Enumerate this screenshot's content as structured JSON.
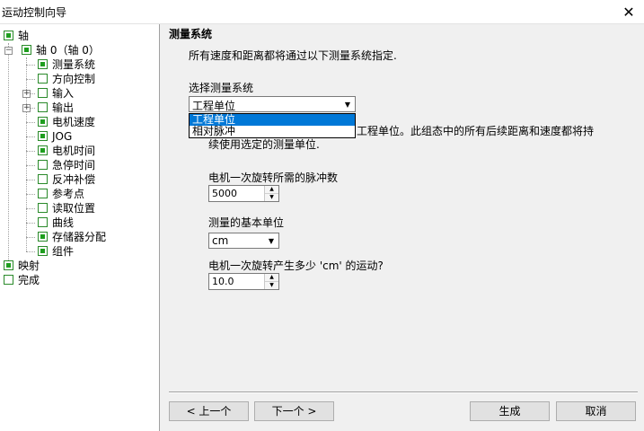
{
  "window": {
    "title": "运动控制向导"
  },
  "tree": {
    "items": [
      {
        "label": "轴",
        "checked": true
      },
      {
        "label": "轴 0（轴 0）",
        "checked": true
      },
      {
        "label": "测量系统",
        "checked": true
      },
      {
        "label": "方向控制",
        "checked": false
      },
      {
        "label": "输入",
        "checked": false
      },
      {
        "label": "输出",
        "checked": false
      },
      {
        "label": "电机速度",
        "checked": true
      },
      {
        "label": "JOG",
        "checked": true
      },
      {
        "label": "电机时间",
        "checked": true
      },
      {
        "label": "急停时间",
        "checked": false
      },
      {
        "label": "反冲补偿",
        "checked": false
      },
      {
        "label": "参考点",
        "checked": false
      },
      {
        "label": "读取位置",
        "checked": false
      },
      {
        "label": "曲线",
        "checked": false
      },
      {
        "label": "存储器分配",
        "checked": true
      },
      {
        "label": "组件",
        "checked": true
      },
      {
        "label": "映射",
        "checked": true
      },
      {
        "label": "完成",
        "checked": false
      }
    ]
  },
  "content": {
    "section_title": "测量系统",
    "description": "所有速度和距离都将通过以下测量系统指定.",
    "select_label": "选择测量系统",
    "select_value": "工程单位",
    "dropdown_options": [
      "工程单位",
      "相对脉冲"
    ],
    "hidden_text": "工程单位。此组态中的所有后续距离和速度都将持",
    "hidden_text_line2": "续使用选定的测量单位.",
    "pulses_label": "电机一次旋转所需的脉冲数",
    "pulses_value": "5000",
    "unit_label": "测量的基本单位",
    "unit_value": "cm",
    "motion_label": "电机一次旋转产生多少 'cm' 的运动?",
    "motion_value": "10.0"
  },
  "buttons": {
    "prev": "< 上一个",
    "next": "下一个 >",
    "generate": "生成",
    "cancel": "取消"
  },
  "colors": {
    "check": "#1e9e1e",
    "selection": "#0078d7"
  }
}
